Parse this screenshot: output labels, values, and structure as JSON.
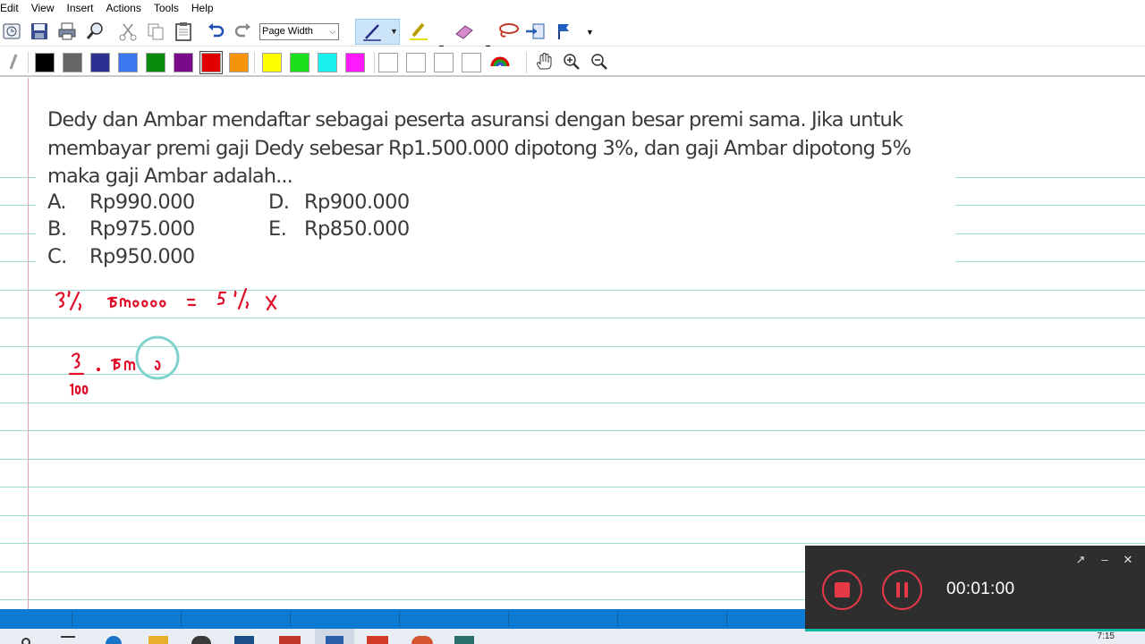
{
  "menu": [
    "Edit",
    "View",
    "Insert",
    "Actions",
    "Tools",
    "Help"
  ],
  "toolbar": {
    "zoom_value": "Page Width",
    "icons": [
      "new-page-icon",
      "save-icon",
      "print-icon",
      "find-icon",
      "cut-icon",
      "copy-icon",
      "paste-icon",
      "undo-icon",
      "redo-icon",
      "pen-icon",
      "highlighter-icon",
      "eraser-icon",
      "lasso-icon",
      "insert-space-icon",
      "flag-icon"
    ]
  },
  "palette": {
    "colors": [
      "#000000",
      "#666666",
      "#2b2f8f",
      "#3b78f0",
      "#0a8a0a",
      "#7a0a8a",
      "#e00000",
      "#f7940a",
      "#ffff00",
      "#19e019",
      "#19f0f0",
      "#ff19ff",
      "#ffffff",
      "#ffffff",
      "#ffffff",
      "#ffffff"
    ],
    "selected_index": 6
  },
  "question": {
    "text": "Dedy dan Ambar mendaftar sebagai peserta asuransi dengan besar premi sama. Jika untuk membayar premi gaji Dedy sebesar Rp1.500.000 dipotong 3%, dan gaji Ambar dipotong 5% maka gaji Ambar adalah...",
    "options": [
      {
        "letter": "A.",
        "value": "Rp990.000"
      },
      {
        "letter": "B.",
        "value": "Rp975.000"
      },
      {
        "letter": "C.",
        "value": "Rp950.000"
      },
      {
        "letter": "D.",
        "value": "Rp900.000"
      },
      {
        "letter": "E.",
        "value": "Rp850.000"
      }
    ]
  },
  "ink": {
    "color": "#e0102a",
    "line1": "3% 15mo00 = 5% x",
    "line2_num": "3",
    "line2_den": "100",
    "line2_rest": ". 15m 0"
  },
  "recorder": {
    "timer": "00:01:00",
    "accent": "#e63948"
  },
  "taskbar": {
    "clock": "7:15"
  }
}
